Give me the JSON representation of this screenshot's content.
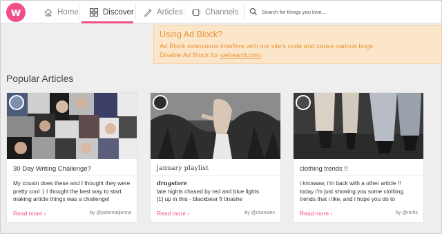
{
  "nav": {
    "logo_letter": "w",
    "items": [
      {
        "label": "Home",
        "icon": "home-icon"
      },
      {
        "label": "Discover",
        "icon": "grid-icon"
      },
      {
        "label": "Articles",
        "icon": "pen-icon"
      },
      {
        "label": "Channels",
        "icon": "channels-icon"
      }
    ],
    "active": "Discover",
    "search_placeholder": "Search for things you love..."
  },
  "adblock": {
    "title": "Using Ad Block?",
    "line1": "Ad Block extensions interfere with our site's code and cause various bugs.",
    "line2_prefix": "Disable Ad Block for ",
    "line2_link": "weheartit.com",
    "line2_suffix": "."
  },
  "section": {
    "title": "Popular Articles"
  },
  "articles": [
    {
      "title": "30 Day Writing Challenge?",
      "lines": [
        "My cousin does these and I thought they were",
        "pretty cool :) I thought the best way to start",
        "making article things was a challenge!"
      ],
      "read_more": "Read more ›",
      "by": "by @palomatijenna"
    },
    {
      "title": "january playlist",
      "subtitle": "drugstore",
      "lines": [
        "late nights chased by red and blue lights",
        "[1] up in this - blackbear ft tinashe"
      ],
      "read_more": "Read more ›",
      "by": "by @clumsies"
    },
    {
      "title": "clothing trends !!",
      "lines": [
        "i knowww, i'm back with a other article !!",
        "today i'm just showing you some clothing",
        "trends that i like, and i hope you do to"
      ],
      "read_more": "Read more ›",
      "by": "by @rmhx"
    }
  ],
  "colors": {
    "brand": "#f04e8c",
    "notice_bg": "#fce6c9",
    "notice_text": "#e8943a"
  }
}
